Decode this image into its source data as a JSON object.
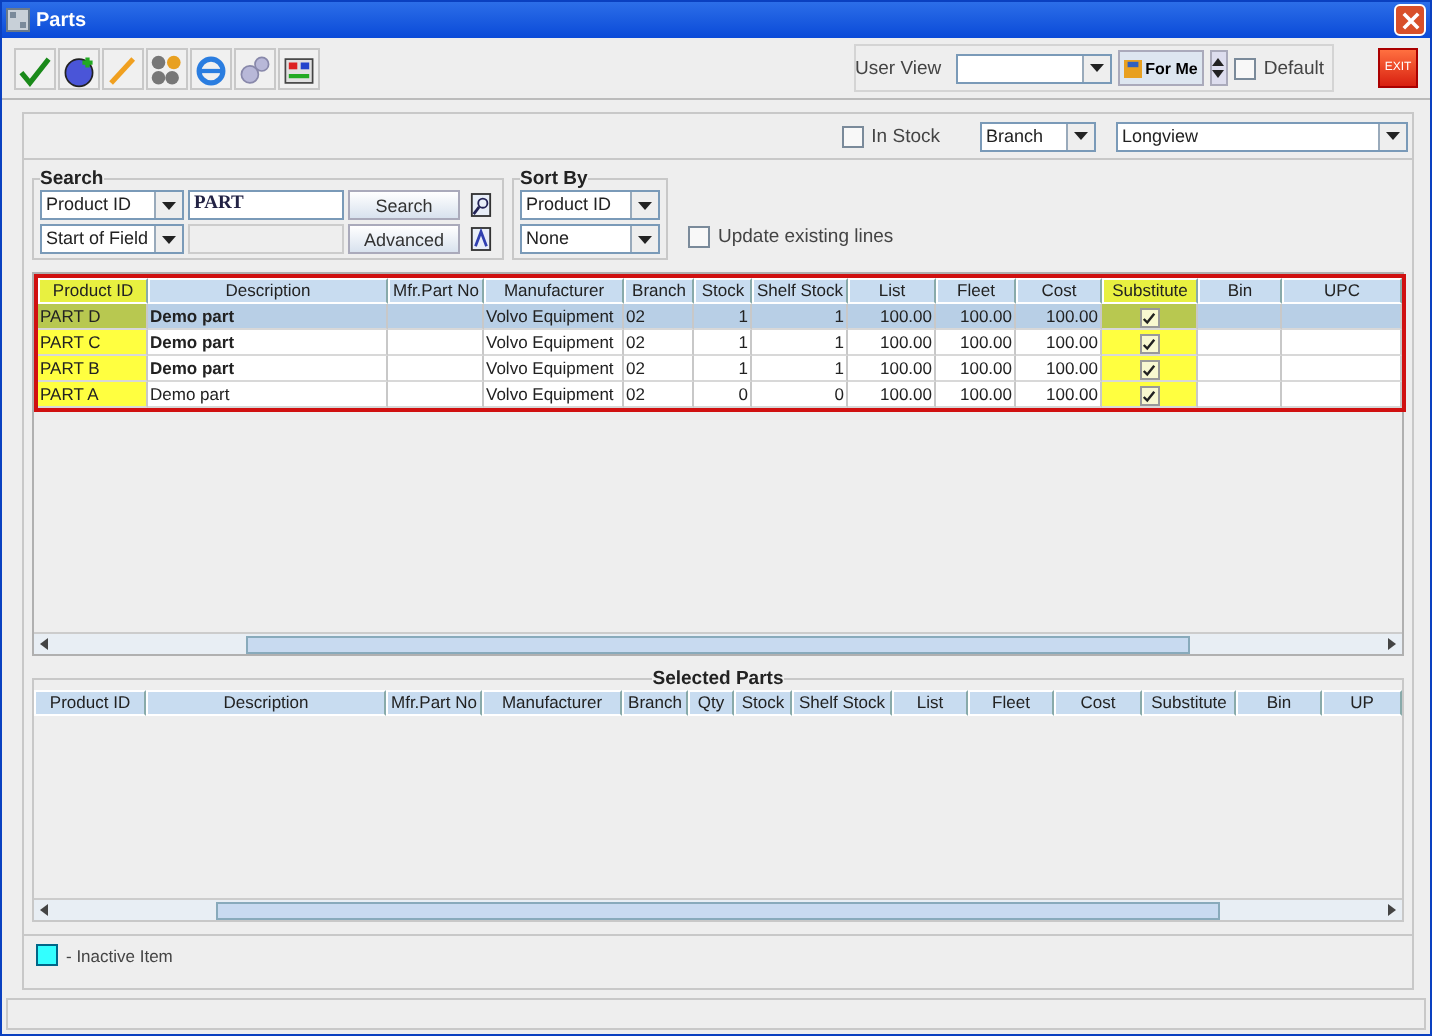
{
  "window": {
    "title": "Parts"
  },
  "toolbar": {
    "user_view_label": "User View",
    "for_me_button": "For Me",
    "default_checkbox": {
      "label": "Default",
      "checked": false
    },
    "exit_button": "EXIT"
  },
  "filters": {
    "in_stock": {
      "label": "In Stock",
      "checked": false
    },
    "branch_dropdown": "Branch",
    "location_dropdown": "Longview"
  },
  "search": {
    "title": "Search",
    "field_dropdown": "Product ID",
    "query": "PART",
    "match_dropdown": "Start of Field",
    "search_button": "Search",
    "advanced_button": "Advanced"
  },
  "sort_by": {
    "title": "Sort By",
    "primary": "Product ID",
    "secondary": "None"
  },
  "update_existing_lines": {
    "label": "Update existing lines",
    "checked": false
  },
  "parts_table": {
    "columns": [
      {
        "label": "Product ID",
        "highlighted": true
      },
      {
        "label": "Description",
        "highlighted": false
      },
      {
        "label": "Mfr.Part No",
        "highlighted": false
      },
      {
        "label": "Manufacturer",
        "highlighted": false
      },
      {
        "label": "Branch",
        "highlighted": false
      },
      {
        "label": "Stock",
        "highlighted": false
      },
      {
        "label": "Shelf Stock",
        "highlighted": false
      },
      {
        "label": "List",
        "highlighted": false
      },
      {
        "label": "Fleet",
        "highlighted": false
      },
      {
        "label": "Cost",
        "highlighted": false
      },
      {
        "label": "Substitute",
        "highlighted": true
      },
      {
        "label": "Bin",
        "highlighted": false
      },
      {
        "label": "UPC",
        "highlighted": false
      }
    ],
    "rows": [
      {
        "product_id": "PART D",
        "description": "Demo part",
        "bold": true,
        "manufacturer": "Volvo Equipment",
        "branch": "02",
        "stock": "1",
        "shelf_stock": "1",
        "list": "100.00",
        "fleet": "100.00",
        "cost": "100.00",
        "substitute": true,
        "selected": true
      },
      {
        "product_id": "PART C",
        "description": "Demo part",
        "bold": true,
        "manufacturer": "Volvo Equipment",
        "branch": "02",
        "stock": "1",
        "shelf_stock": "1",
        "list": "100.00",
        "fleet": "100.00",
        "cost": "100.00",
        "substitute": true,
        "selected": false
      },
      {
        "product_id": "PART B",
        "description": "Demo part",
        "bold": true,
        "manufacturer": "Volvo Equipment",
        "branch": "02",
        "stock": "1",
        "shelf_stock": "1",
        "list": "100.00",
        "fleet": "100.00",
        "cost": "100.00",
        "substitute": true,
        "selected": false
      },
      {
        "product_id": "PART A",
        "description": "Demo part",
        "bold": false,
        "manufacturer": "Volvo Equipment",
        "branch": "02",
        "stock": "0",
        "shelf_stock": "0",
        "list": "100.00",
        "fleet": "100.00",
        "cost": "100.00",
        "substitute": true,
        "selected": false
      }
    ]
  },
  "selected_parts": {
    "title": "Selected Parts",
    "columns": [
      "Product ID",
      "Description",
      "Mfr.Part No",
      "Manufacturer",
      "Branch",
      "Qty",
      "Stock",
      "Shelf Stock",
      "List",
      "Fleet",
      "Cost",
      "Substitute",
      "Bin",
      "UP"
    ]
  },
  "legend": {
    "color": "#33ffff",
    "label": "- Inactive Item"
  }
}
